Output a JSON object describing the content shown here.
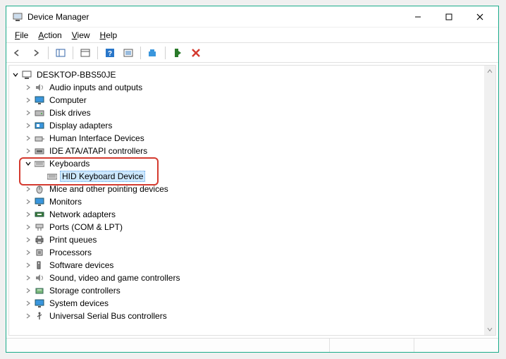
{
  "window": {
    "title": "Device Manager"
  },
  "menu": {
    "file": "File",
    "action": "Action",
    "view": "View",
    "help": "Help"
  },
  "tree": {
    "root": "DESKTOP-BBS50JE",
    "audio": "Audio inputs and outputs",
    "computer": "Computer",
    "disk": "Disk drives",
    "display": "Display adapters",
    "hid": "Human Interface Devices",
    "ide": "IDE ATA/ATAPI controllers",
    "keyboards": "Keyboards",
    "hid_keyboard": "HID Keyboard Device",
    "mice": "Mice and other pointing devices",
    "monitors": "Monitors",
    "network": "Network adapters",
    "ports": "Ports (COM & LPT)",
    "print": "Print queues",
    "processors": "Processors",
    "software": "Software devices",
    "sound": "Sound, video and game controllers",
    "storage": "Storage controllers",
    "system": "System devices",
    "usb": "Universal Serial Bus controllers"
  }
}
